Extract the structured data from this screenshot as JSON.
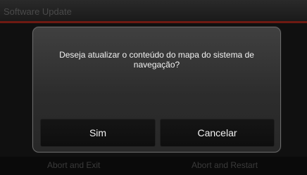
{
  "header": {
    "title": "Software Update"
  },
  "footer": {
    "abort_exit_label": "Abort and Exit",
    "abort_restart_label": "Abort and Restart"
  },
  "dialog": {
    "message": "Deseja atualizar o conteúdo do mapa do sistema de navegação?",
    "yes_label": "Sim",
    "cancel_label": "Cancelar"
  },
  "colors": {
    "accent_line": "#6e1a12",
    "dialog_bg": "#353535",
    "button_bg": "#121212"
  }
}
